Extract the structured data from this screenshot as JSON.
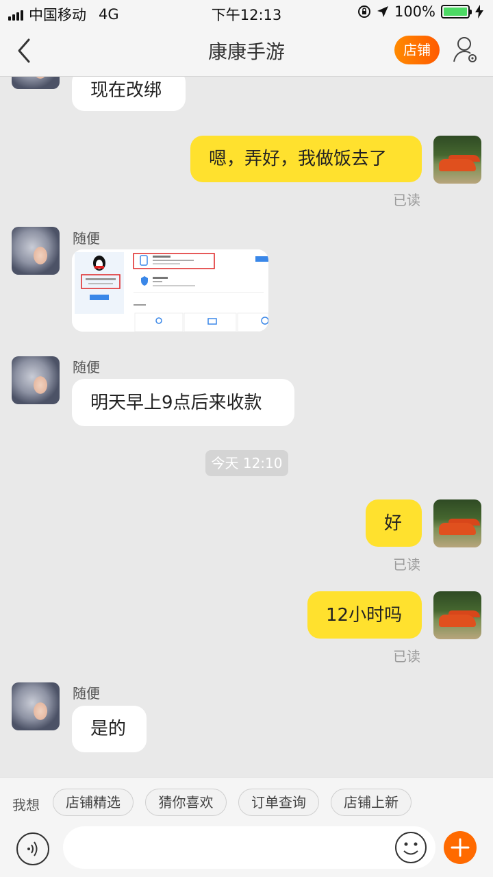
{
  "status_bar": {
    "carrier": "中国移动",
    "network": "4G",
    "time": "下午12:13",
    "battery": "100%"
  },
  "nav": {
    "title": "康康手游",
    "shop_button": "店铺"
  },
  "messages": {
    "m1_text": "现在改绑",
    "m2_text": "嗯，弄好，我做饭去了",
    "m2_status": "已读",
    "m3_sender": "随便",
    "m4_sender": "随便",
    "m4_text": "明天早上9点后来收款",
    "time_divider": "今天 12:10",
    "m5_text": "好",
    "m5_status": "已读",
    "m6_text": "12小时吗",
    "m6_status": "已读",
    "m7_sender": "随便",
    "m7_text": "是的"
  },
  "bottom": {
    "want_label": "我想",
    "chips": [
      "店铺精选",
      "猜你喜欢",
      "订单查询",
      "店铺上新"
    ],
    "input_placeholder": ""
  },
  "colors": {
    "incoming_bubble": "#ffffff",
    "outgoing_bubble": "#ffe12e",
    "accent_orange": "#ff6a00"
  }
}
